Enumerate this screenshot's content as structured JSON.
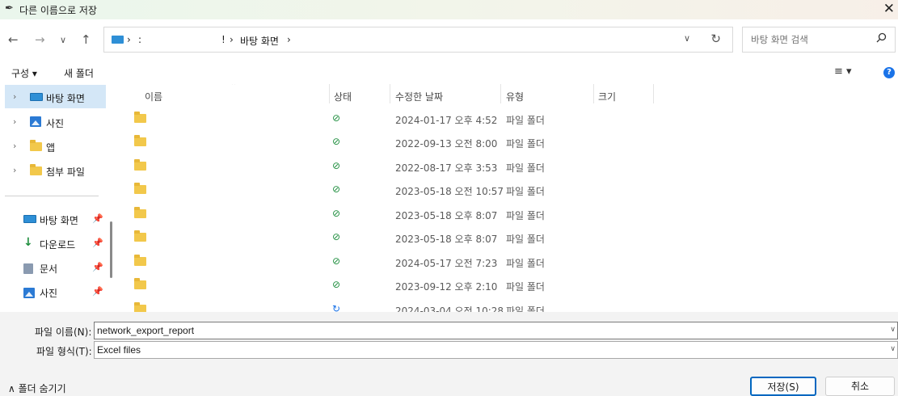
{
  "window": {
    "title": "다른 이름으로 저장",
    "close": "✕"
  },
  "nav_buttons": {
    "back": "←",
    "forward": "→",
    "recent": "∨",
    "up": "↑"
  },
  "address": {
    "sep1": "›",
    "mark": ":",
    "mark2": "!",
    "sep2": "›",
    "current": "바탕 화면",
    "sep3": "›",
    "dropdown": "∨",
    "refresh": "↻"
  },
  "search": {
    "placeholder": "바탕 화면 검색",
    "icon": "⌕"
  },
  "toolbar": {
    "organize": "구성 ▾",
    "new_folder": "새 폴더",
    "view": "≡ ▾",
    "help": "?"
  },
  "nav_tree": [
    {
      "label": "바탕 화면",
      "icon": "desktop-icon",
      "selected": true
    },
    {
      "label": "사진",
      "icon": "pictures-icon"
    },
    {
      "label": "앱",
      "icon": "folder-icon"
    },
    {
      "label": "첨부 파일",
      "icon": "folder-icon"
    }
  ],
  "quick_access": [
    {
      "label": "바탕 화면",
      "icon": "desktop-icon"
    },
    {
      "label": "다운로드",
      "icon": "download-icon"
    },
    {
      "label": "문서",
      "icon": "document-icon"
    },
    {
      "label": "사진",
      "icon": "pictures-icon"
    }
  ],
  "columns": {
    "name": "이름",
    "status": "상태",
    "modified": "수정한 날짜",
    "type": "유형",
    "size": "크기"
  },
  "files": [
    {
      "name": "",
      "status": "synced",
      "modified": "2024-01-17 오후 4:52",
      "type": "파일 폴더"
    },
    {
      "name": "",
      "status": "synced",
      "modified": "2022-09-13 오전 8:00",
      "type": "파일 폴더"
    },
    {
      "name": "",
      "status": "synced",
      "modified": "2022-08-17 오후 3:53",
      "type": "파일 폴더"
    },
    {
      "name": "",
      "status": "synced",
      "modified": "2023-05-18 오전 10:57",
      "type": "파일 폴더"
    },
    {
      "name": "",
      "status": "synced",
      "modified": "2023-05-18 오후 8:07",
      "type": "파일 폴더"
    },
    {
      "name": "",
      "status": "synced",
      "modified": "2023-05-18 오후 8:07",
      "type": "파일 폴더"
    },
    {
      "name": "",
      "status": "synced",
      "modified": "2024-05-17 오전 7:23",
      "type": "파일 폴더"
    },
    {
      "name": "",
      "status": "synced",
      "modified": "2023-09-12 오후 2:10",
      "type": "파일 폴더"
    },
    {
      "name": "",
      "status": "syncing",
      "modified": "2024-03-04 오전 10:28",
      "type": "파일 폴더"
    }
  ],
  "form": {
    "filename_label": "파일 이름(N):",
    "filename_value": "network_export_report",
    "filetype_label": "파일 형식(T):",
    "filetype_value": "Excel files"
  },
  "footer": {
    "hide_folders": "∧  폴더 숨기기",
    "save": "저장(S)",
    "cancel": "취소"
  }
}
